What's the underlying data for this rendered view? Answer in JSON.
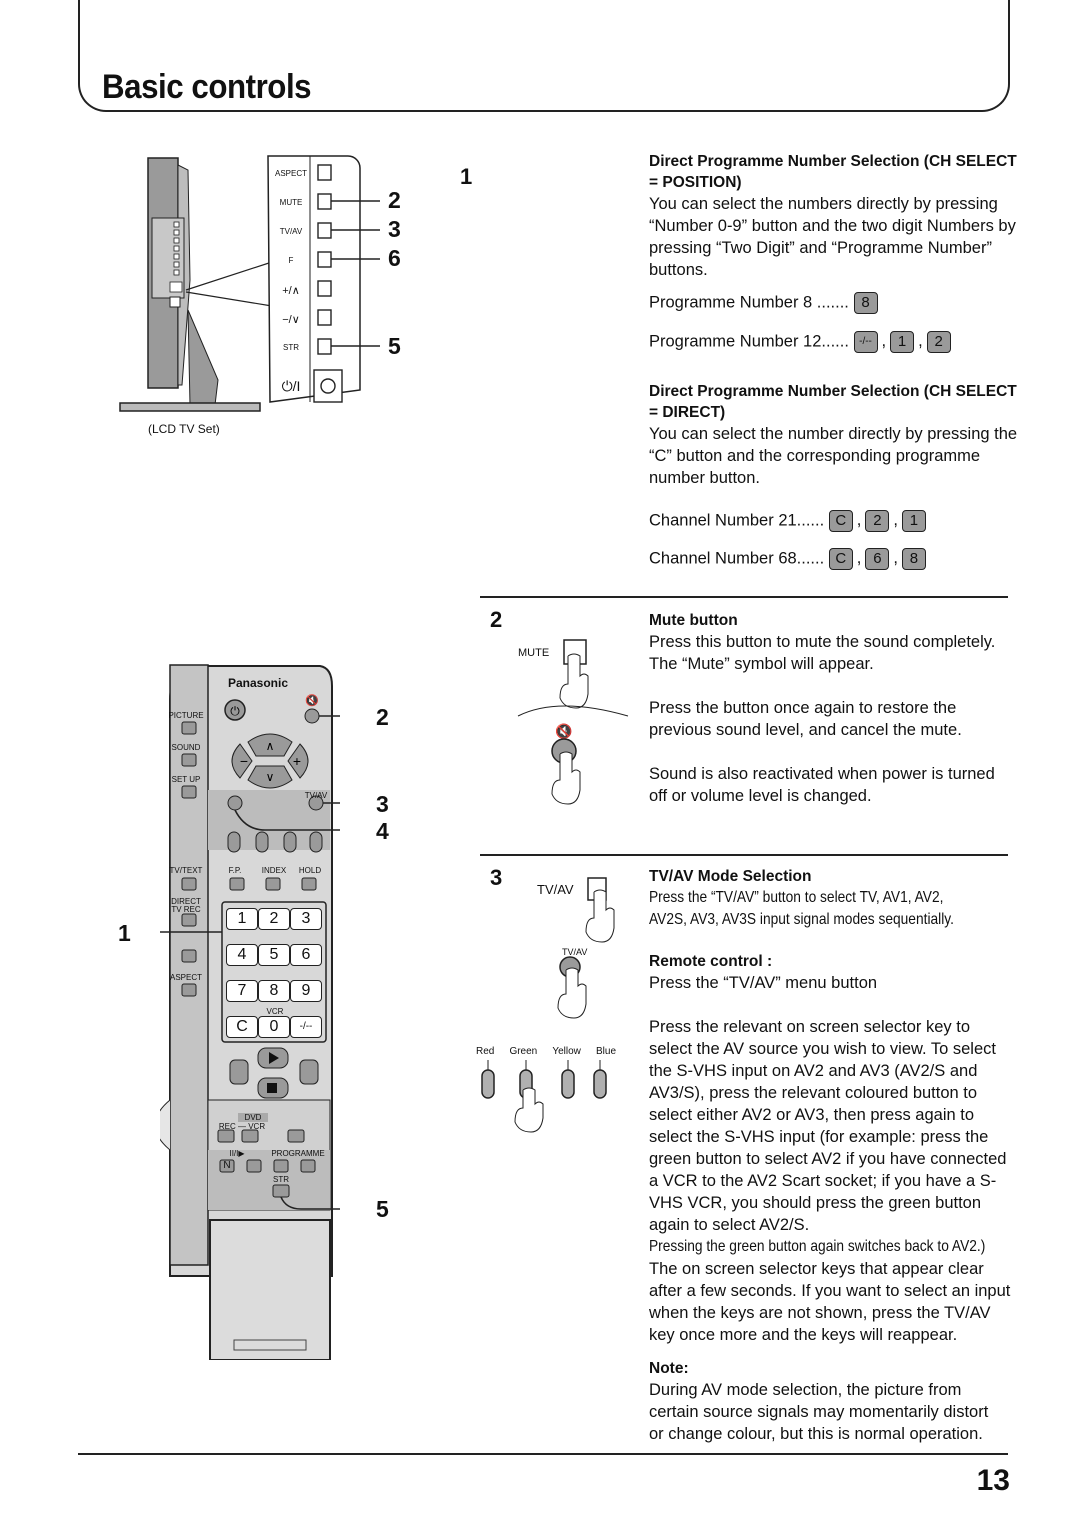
{
  "page": {
    "title": "Basic controls",
    "page_number": "13"
  },
  "tv_figure": {
    "caption": "(LCD TV Set)",
    "side_panel_labels": [
      "ASPECT",
      "MUTE",
      "TV/AV",
      "F",
      "+/∧",
      "−/∨",
      "STR",
      "⏻/I"
    ],
    "callouts": [
      "2",
      "3",
      "6",
      "5"
    ]
  },
  "remote_figure": {
    "brand": "Panasonic",
    "left_labels": [
      "PICTURE",
      "SOUND",
      "SET UP",
      "TV/TEXT",
      "DIRECT TV REC",
      "ASPECT"
    ],
    "top_labels": [
      "F.P.",
      "INDEX",
      "HOLD"
    ],
    "keypad": [
      "1",
      "2",
      "3",
      "4",
      "5",
      "6",
      "7",
      "8",
      "9",
      "C",
      "0",
      "-/--"
    ],
    "vcr_label": "VCR",
    "tv_av_label": "TV/AV",
    "dvd_label": "DVD",
    "rec_vcr_label": "REC — VCR",
    "programme_label": "PROGRAMME",
    "pause_label": "II/I▶",
    "n_key": "N",
    "str_label": "STR",
    "callouts": [
      "2",
      "3",
      "4",
      "1",
      "5"
    ]
  },
  "section1": {
    "number": "1",
    "heading_position": "Direct Programme Number Selection (CH SELECT = POSITION)",
    "body_position": "You can select the numbers directly by pressing “Number 0-9” button and the two digit Numbers by pressing “Two Digit” and “Programme Number” buttons.",
    "examples_position": [
      {
        "label": "Programme Number 8 .......",
        "keys": [
          "8"
        ]
      },
      {
        "label": "Programme Number 12......",
        "keys": [
          "-/--",
          "1",
          "2"
        ]
      }
    ],
    "heading_direct": "Direct Programme Number Selection (CH SELECT = DIRECT)",
    "body_direct": "You can select the number directly by pressing the “C” button and the corresponding programme number button.",
    "examples_direct": [
      {
        "label": "Channel Number 21......",
        "keys": [
          "C",
          "2",
          "1"
        ]
      },
      {
        "label": "Channel Number 68......",
        "keys": [
          "C",
          "6",
          "8"
        ]
      }
    ]
  },
  "section2": {
    "number": "2",
    "illus_label": "MUTE",
    "heading": "Mute button",
    "para1": "Press this button to mute the sound completely.",
    "para1b": "The “Mute” symbol will appear.",
    "para2": "Press the button once again to restore the previous sound level, and cancel the mute.",
    "para3": "Sound is also reactivated when power is turned off or volume level is changed."
  },
  "section3": {
    "number": "3",
    "illus_label_tv": "TV/AV",
    "illus_label_remote": "TV/AV",
    "color_buttons": [
      "Red",
      "Green",
      "Yellow",
      "Blue"
    ],
    "heading": "TV/AV Mode Selection",
    "line1": "Press the “TV/AV” button to select TV, AV1, AV2,",
    "line2": "AV2S, AV3, AV3S input signal modes sequentially.",
    "remote_heading": "Remote control :",
    "remote_body": "Press the “TV/AV” menu button",
    "para": "Press the relevant on screen selector key to select the AV source you wish to view. To select the S-VHS input on AV2 and AV3 (AV2/S and AV3/S), press the relevant coloured button to select either AV2 or AV3, then press again to select the S-VHS input (for example: press the green button to select AV2 if you have connected a VCR to the AV2 Scart socket; if you have a S-VHS VCR, you should press the green button again to select AV2/S.",
    "para_cond": "Pressing the green button again switches back to AV2.)",
    "para2": "The on screen selector keys that appear clear after a few seconds. If you want to select an input when the keys are not shown, press the TV/AV key once more and the keys will reappear.",
    "note_heading": "Note:",
    "note_body": "During AV mode selection, the picture from certain source signals may momentarily distort or change colour, but this is normal operation."
  }
}
